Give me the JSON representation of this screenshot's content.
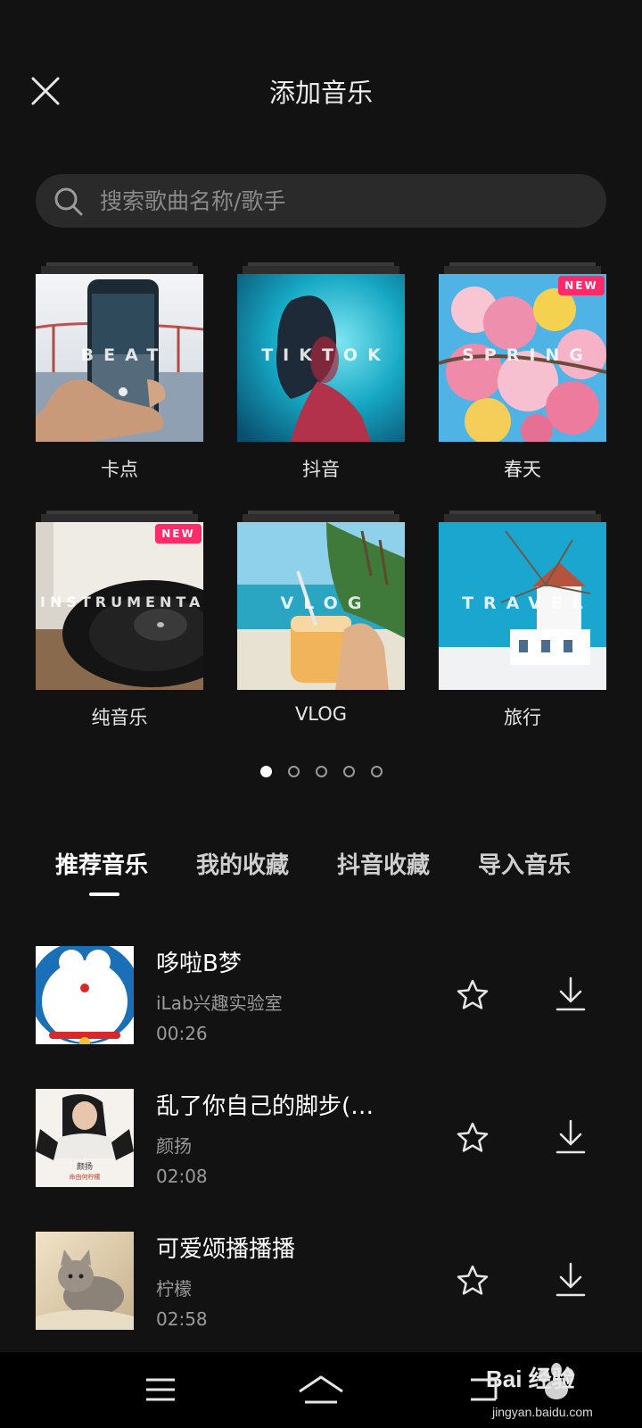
{
  "header": {
    "title": "添加音乐",
    "close_icon": "close-icon"
  },
  "search": {
    "placeholder": "搜索歌曲名称/歌手",
    "value": ""
  },
  "categories": [
    {
      "label": "卡点",
      "cover_text": "BEAT",
      "badge": ""
    },
    {
      "label": "抖音",
      "cover_text": "TIKTOK",
      "badge": ""
    },
    {
      "label": "春天",
      "cover_text": "SPRING",
      "badge": "NEW"
    },
    {
      "label": "纯音乐",
      "cover_text": "INSTRUMENTAL",
      "badge": "NEW"
    },
    {
      "label": "VLOG",
      "cover_text": "VLOG",
      "badge": ""
    },
    {
      "label": "旅行",
      "cover_text": "TRAVEL",
      "badge": ""
    }
  ],
  "pagination": {
    "pages": 5,
    "active": 1
  },
  "tabs": [
    {
      "label": "推荐音乐",
      "active": true
    },
    {
      "label": "我的收藏",
      "active": false
    },
    {
      "label": "抖音收藏",
      "active": false
    },
    {
      "label": "导入音乐",
      "active": false
    }
  ],
  "songs": [
    {
      "title": "哆啦B梦",
      "artist": "iLab兴趣实验室",
      "duration": "00:26"
    },
    {
      "title": "乱了你自己的脚步(…",
      "artist": "颜扬",
      "duration": "02:08"
    },
    {
      "title": "可爱颂播播播",
      "artist": "柠檬",
      "duration": "02:58"
    }
  ],
  "thumb_text": {
    "song2_name": "颜扬",
    "song2_sub": "命由何柠檬"
  },
  "watermark": {
    "brand": "Bai 经验",
    "url": "jingyan.baidu.com"
  },
  "colors": {
    "background": "#121212",
    "badge": "#ff2a68",
    "search_bg": "#2a2a2a"
  }
}
